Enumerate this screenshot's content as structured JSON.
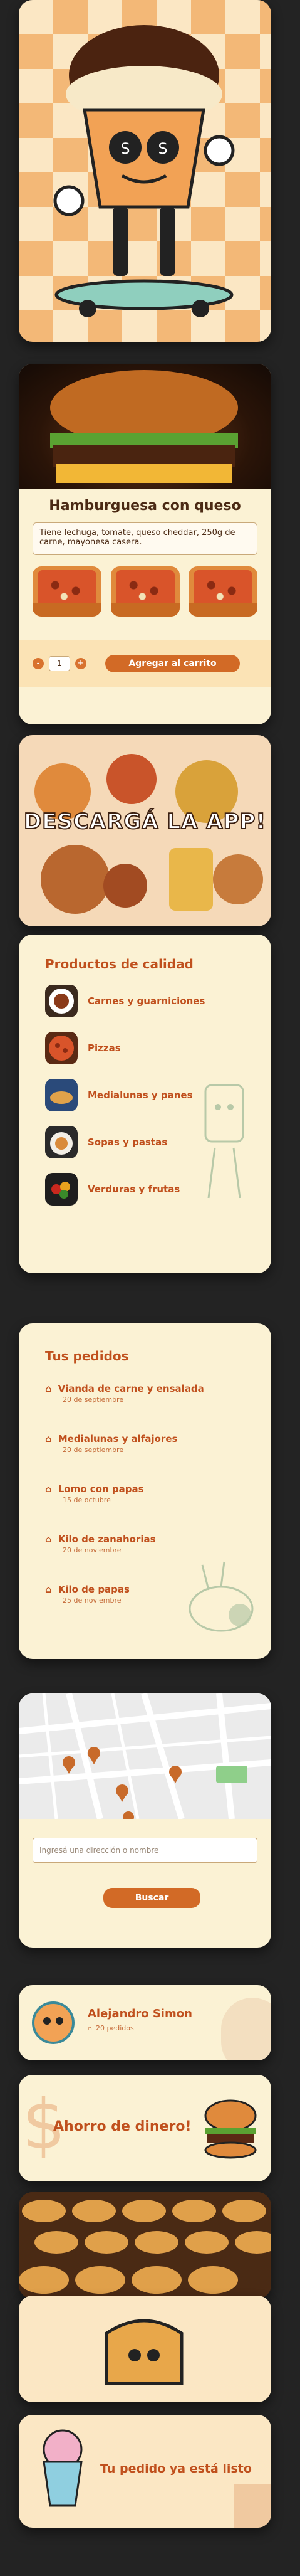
{
  "product": {
    "title": "Hamburguesa con queso",
    "description": "Tiene lechuga, tomate, queso cheddar, 250g de carne, mayonesa casera.",
    "quantity": "1",
    "minus": "-",
    "plus": "+",
    "add_to_cart": "Agregar al carrito"
  },
  "banner": {
    "title": "DESCARGÁ LA APP!"
  },
  "products": {
    "title": "Productos de calidad",
    "items": [
      {
        "label": "Carnes y guarniciones"
      },
      {
        "label": "Pizzas"
      },
      {
        "label": "Medialunas y panes"
      },
      {
        "label": "Sopas y pastas"
      },
      {
        "label": "Verduras y frutas"
      }
    ]
  },
  "orders": {
    "title": "Tus pedidos",
    "items": [
      {
        "name": "Vianda de carne y ensalada",
        "date": "20 de septiembre"
      },
      {
        "name": "Medialunas y alfajores",
        "date": "20 de septiembre"
      },
      {
        "name": "Lomo con papas",
        "date": "15 de octubre"
      },
      {
        "name": "Kilo de zanahorias",
        "date": "20 de noviembre"
      },
      {
        "name": "Kilo de papas",
        "date": "25 de noviembre"
      }
    ]
  },
  "map_search": {
    "placeholder": "Ingresá una dirección o nombre",
    "button": "Buscar"
  },
  "profile": {
    "name": "Alejandro Simon",
    "orders": "20 pedidos"
  },
  "savings": {
    "title": "Ahorro de dinero!",
    "symbol": "$"
  },
  "ready": {
    "title": "Tu pedido ya está listo"
  },
  "colors": {
    "accent": "#d26a26",
    "cream": "#fbf2d4",
    "brown": "#4b2a14"
  }
}
